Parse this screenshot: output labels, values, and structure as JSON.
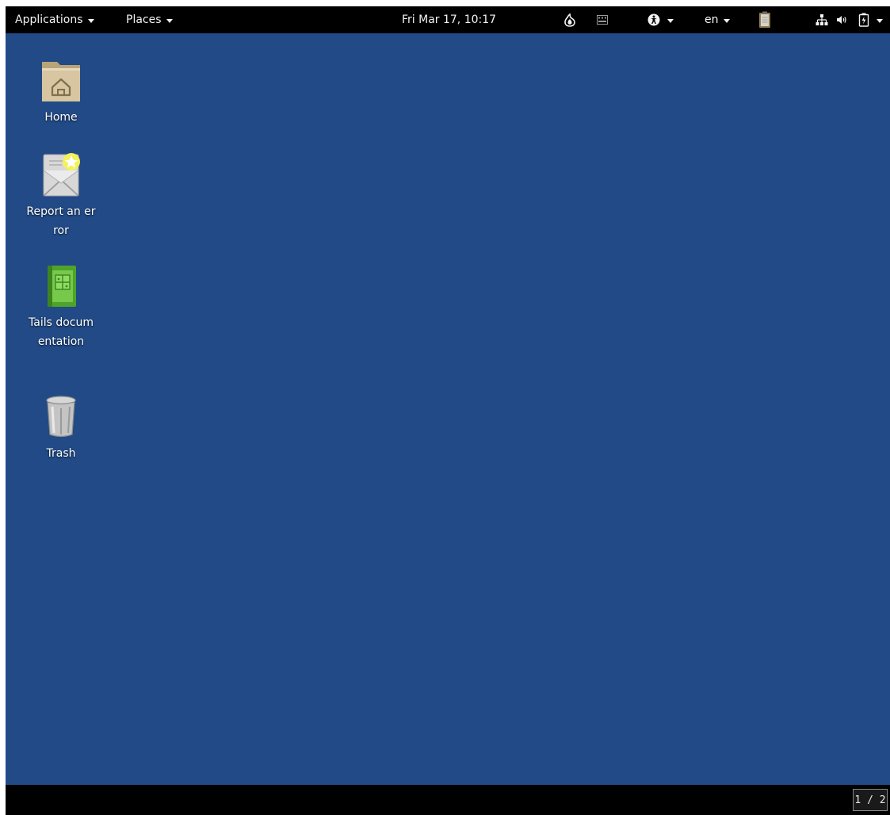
{
  "top_panel": {
    "applications_menu": "Applications",
    "places_menu": "Places",
    "clock": "Fri Mar 17, 10:17",
    "keyboard_layout": "en",
    "tray_icons": [
      "tor-onion-icon",
      "screen-keyboard-icon",
      "accessibility-icon",
      "clipboard-icon",
      "network-icon",
      "volume-icon",
      "battery-icon"
    ]
  },
  "desktop": {
    "background_color": "#214a86",
    "icons": [
      {
        "label": "Home",
        "icon": "home-folder-icon"
      },
      {
        "label": "Report an error",
        "icon": "report-error-icon"
      },
      {
        "label": "Tails documentation",
        "icon": "tails-documentation-icon"
      },
      {
        "label": "Trash",
        "icon": "trash-icon"
      }
    ]
  },
  "bottom_panel": {
    "workspace_indicator": "1 / 2"
  }
}
